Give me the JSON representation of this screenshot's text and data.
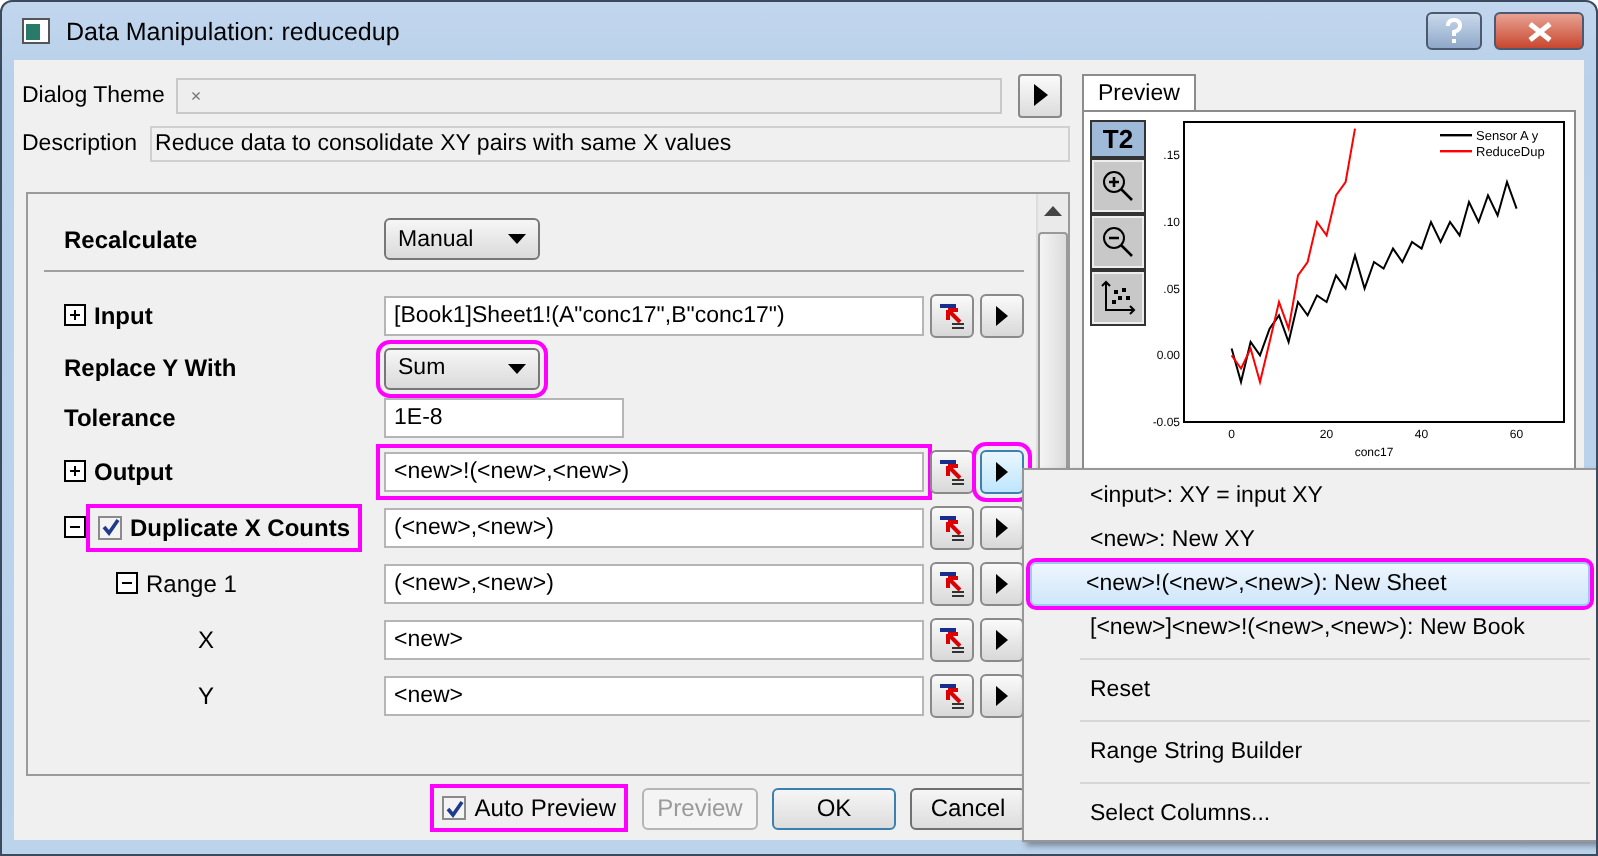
{
  "window": {
    "title": "Data Manipulation: reducedup"
  },
  "theme": {
    "label": "Dialog Theme",
    "placeholder": "×"
  },
  "description": {
    "label": "Description",
    "value": "Reduce data to consolidate XY pairs with same X values"
  },
  "settings": [
    {
      "kind": "dropdown",
      "label": "Recalculate",
      "value": "Manual"
    },
    {
      "kind": "range",
      "label": "Input",
      "value": "[Book1]Sheet1!(A\"conc17\",B\"conc17\")",
      "expanded": false
    },
    {
      "kind": "dropdown",
      "label": "Replace Y With",
      "value": "Sum",
      "highlighted": true
    },
    {
      "kind": "text",
      "label": "Tolerance",
      "value": "1E-8"
    },
    {
      "kind": "range",
      "label": "Output",
      "value": "<new>!(<new>,<new>)",
      "expanded": false,
      "highlighted": true,
      "menu_open": true
    },
    {
      "kind": "range",
      "label": "Duplicate X Counts",
      "value": "(<new>,<new>)",
      "expanded": true,
      "checked": true,
      "highlighted": true,
      "children": [
        {
          "kind": "range",
          "label": "Range 1",
          "value": "(<new>,<new>)",
          "expanded": true,
          "children": [
            {
              "kind": "range",
              "label": "X",
              "value": "<new>"
            },
            {
              "kind": "range",
              "label": "Y",
              "value": "<new>"
            }
          ]
        }
      ]
    }
  ],
  "auto_preview": {
    "label": "Auto Preview",
    "checked": true,
    "highlighted": true
  },
  "buttons": [
    {
      "label": "Preview",
      "disabled": true,
      "default": false
    },
    {
      "label": "OK",
      "disabled": false,
      "default": true
    },
    {
      "label": "Cancel",
      "disabled": false,
      "default": false
    }
  ],
  "preview": {
    "tab": {
      "label": "Preview",
      "selected": true
    },
    "toolbar_label": "T2",
    "chart_data": {
      "type": "line",
      "xlabel": "conc17",
      "x": [
        0,
        2,
        4,
        6,
        8,
        10,
        12,
        14,
        16,
        18,
        20,
        22,
        24,
        26,
        28,
        30,
        32,
        34,
        36,
        38,
        40,
        42,
        44,
        46,
        48,
        50,
        52,
        54,
        56,
        58,
        60
      ],
      "series": [
        {
          "name": "Sensor A y",
          "color": "#000000",
          "values": [
            0.005,
            -0.02,
            0.01,
            0.0,
            0.02,
            0.03,
            0.01,
            0.04,
            0.03,
            0.045,
            0.04,
            0.06,
            0.05,
            0.075,
            0.05,
            0.07,
            0.065,
            0.08,
            0.07,
            0.085,
            0.08,
            0.1,
            0.085,
            0.1,
            0.09,
            0.115,
            0.1,
            0.12,
            0.105,
            0.13,
            0.11
          ]
        },
        {
          "name": "ReduceDup",
          "color": "#ff0000",
          "values": [
            0.0,
            -0.01,
            0.005,
            -0.02,
            0.01,
            0.04,
            0.02,
            0.06,
            0.07,
            0.1,
            0.09,
            0.12,
            0.13,
            0.17,
            null,
            null,
            null,
            null,
            null,
            null,
            null,
            null,
            null,
            null,
            null,
            null,
            null,
            null,
            null,
            null,
            null
          ]
        }
      ],
      "legend": true,
      "xlim": [
        -10,
        70
      ],
      "ylim": [
        -0.05,
        0.175
      ],
      "xticks": [
        0,
        20,
        40,
        60
      ],
      "yticks": [
        {
          "value": 0.15,
          "label": ".15"
        },
        {
          "value": 0.1,
          "label": ".10"
        },
        {
          "value": 0.05,
          "label": ".05"
        },
        {
          "value": 0,
          "label": "0.00"
        },
        {
          "value": -0.05,
          "label": "-0.05"
        }
      ]
    }
  },
  "menu": {
    "groups": [
      [
        {
          "label": "<input>: XY = input XY",
          "selected": false
        },
        {
          "label": "<new>: New XY",
          "selected": false
        },
        {
          "label": "<new>!(<new>,<new>): New Sheet",
          "selected": true,
          "highlighted": true
        },
        {
          "label": "[<new>]<new>!(<new>,<new>): New Book",
          "selected": false
        }
      ],
      [
        {
          "label": "Reset",
          "selected": false
        }
      ],
      [
        {
          "label": "Range String Builder",
          "selected": false
        }
      ],
      [
        {
          "label": "Select Columns...",
          "selected": false
        }
      ]
    ]
  }
}
